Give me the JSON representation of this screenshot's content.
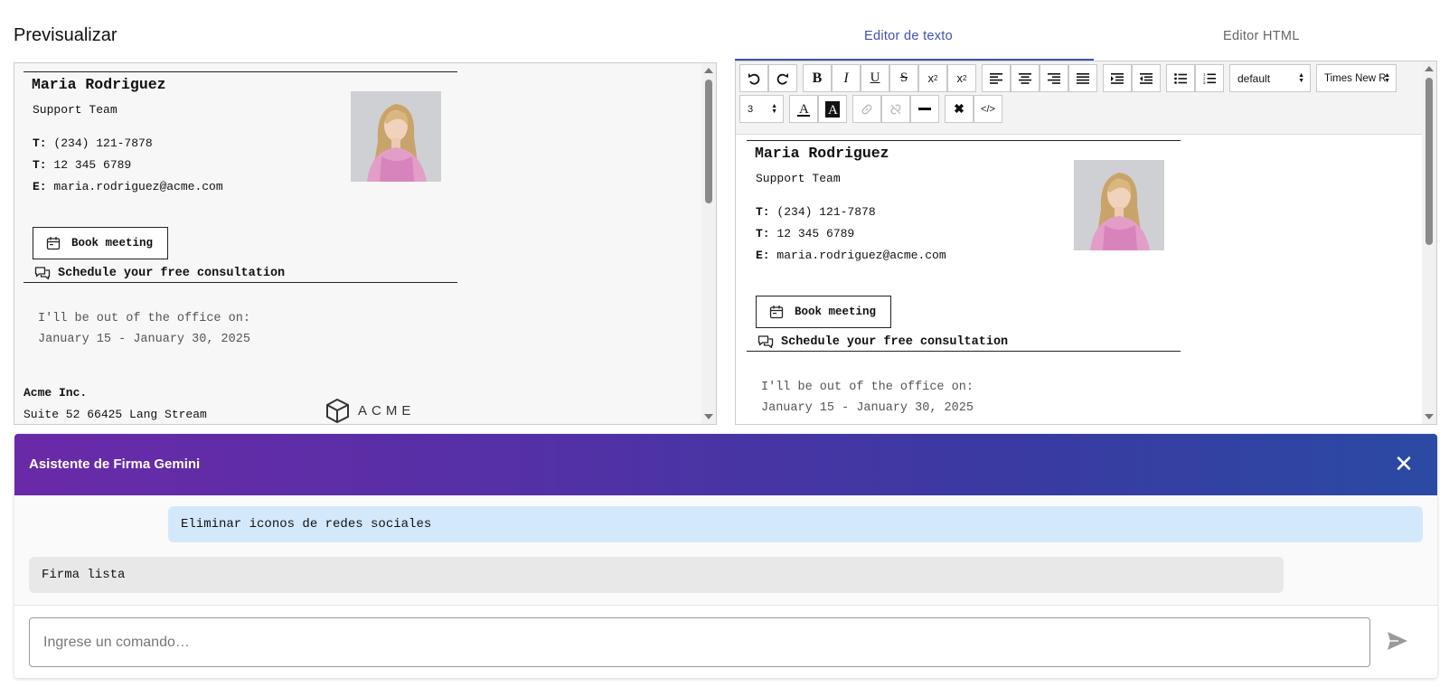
{
  "preview": {
    "title": "Previsualizar"
  },
  "tabs": [
    {
      "label": "Editor de texto"
    },
    {
      "label": "Editor HTML"
    }
  ],
  "toolbar": {
    "format_select": "default",
    "font_select": "Times New R",
    "size_select": "3"
  },
  "signature": {
    "name": "Maria Rodriguez",
    "team": "Support Team",
    "phone1_label": "T:",
    "phone1": "(234) 121-7878",
    "phone2_label": "T:",
    "phone2": "12 345 6789",
    "email_label": "E:",
    "email": "maria.rodriguez@acme.com",
    "book_label": "Book meeting",
    "schedule_label": "Schedule your free consultation",
    "ooo_line1": "I'll be out of the office on:",
    "ooo_line2": "January 15 - January 30, 2025",
    "company": "Acme Inc.",
    "address": "Suite 52 66425 Lang Stream",
    "logo_text": "ACME"
  },
  "assistant": {
    "title": "Asistente de Firma Gemini",
    "user_message": "Eliminar iconos de redes sociales",
    "bot_message": "Firma lista",
    "input_placeholder": "Ingrese un comando…",
    "input_value": ""
  },
  "colors": {
    "accent": "#3f51b5",
    "header_gradient_start": "#6a2aa8",
    "header_gradient_end": "#2b4aa3",
    "user_bubble": "#d4e8fb",
    "bot_bubble": "#e8e8e8"
  }
}
